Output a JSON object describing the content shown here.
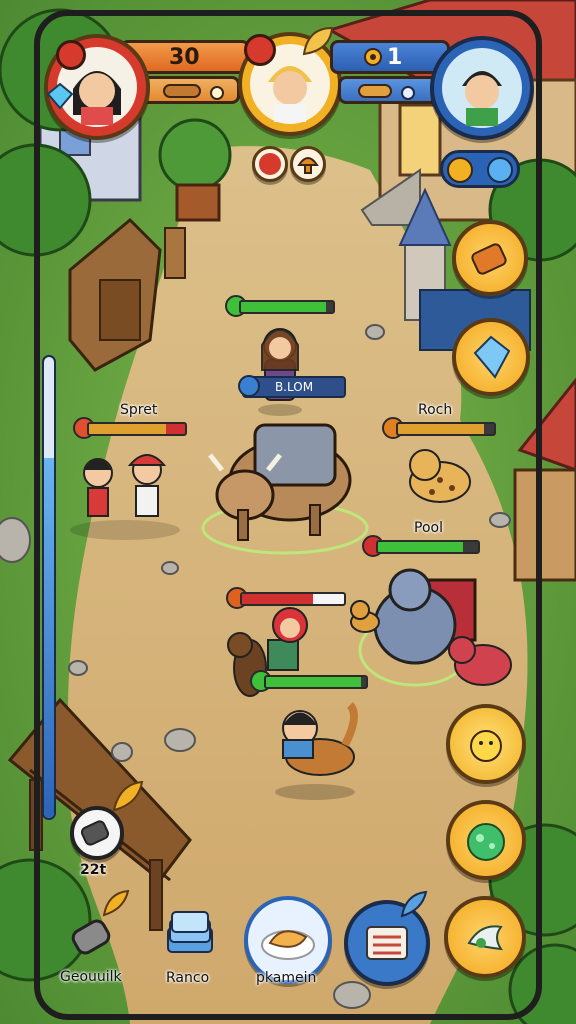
{
  "hud": {
    "left_player": {
      "score": "30",
      "avatar_icon": "girl-avatar-icon"
    },
    "center_player": {
      "avatar_icon": "blonde-boy-avatar-icon"
    },
    "right_player": {
      "score": "1",
      "avatar_icon": "dark-hair-boy-avatar-icon"
    }
  },
  "units": [
    {
      "id": "player-unit",
      "label": "",
      "hp": 0.92,
      "color": "#3fbf3a",
      "icon_color": "#3fbf3a"
    },
    {
      "id": "blom-unit",
      "label": "B.LOM",
      "hp": 0.75,
      "color": "#3a7fd0",
      "icon_color": "#3a7fd0"
    },
    {
      "id": "spre-unit",
      "label": "Spret",
      "hp": 0.8,
      "color": "#e0a030",
      "icon_color": "#e05030"
    },
    {
      "id": "roch-unit",
      "label": "Roch",
      "hp": 0.9,
      "color": "#e0a030",
      "icon_color": "#e08020"
    },
    {
      "id": "pool-unit",
      "label": "Pool",
      "hp": 0.85,
      "color": "#3fbf3a",
      "icon_color": "#d03030"
    },
    {
      "id": "enemy-unit",
      "label": "",
      "hp": 0.7,
      "color": "#d03030",
      "icon_color": "#e06020"
    },
    {
      "id": "ally-unit",
      "label": "",
      "hp": 0.95,
      "color": "#3fbf3a",
      "icon_color": "#3fbf3a"
    }
  ],
  "side_meter": {
    "level": 0.78
  },
  "bottom_bar": {
    "counter_label": "22t",
    "buttons": [
      {
        "label": "Geouuilk",
        "icon": "wrench-icon"
      },
      {
        "label": "Ranco",
        "icon": "card-stack-icon"
      },
      {
        "label": "pkamein",
        "icon": "food-plate-icon"
      },
      {
        "label": "",
        "icon": "scroll-icon"
      }
    ]
  },
  "right_actions": [
    {
      "icon": "bag-icon"
    },
    {
      "icon": "crystal-icon"
    },
    {
      "icon": "chick-icon"
    },
    {
      "icon": "potion-icon"
    },
    {
      "icon": "dragon-icon"
    }
  ],
  "colors": {
    "gold": "#f2b124",
    "wood": "#6b4323",
    "grass": "#6da844",
    "path": "#d8b883",
    "blue_ui": "#2c64b5",
    "orange_ui": "#e86f27"
  }
}
